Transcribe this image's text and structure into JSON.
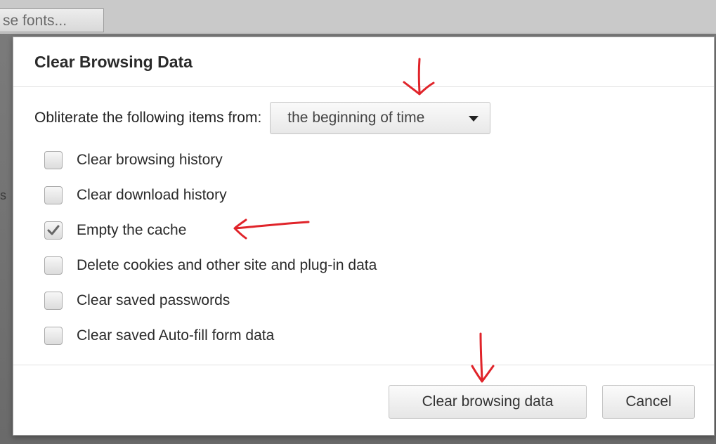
{
  "background": {
    "fonts_button_text": "se fonts..."
  },
  "dialog": {
    "title": "Clear Browsing Data",
    "time_range": {
      "label": "Obliterate the following items from:",
      "selected": "the beginning of time"
    },
    "options": [
      {
        "label": "Clear browsing history",
        "checked": false
      },
      {
        "label": "Clear download history",
        "checked": false
      },
      {
        "label": "Empty the cache",
        "checked": true
      },
      {
        "label": "Delete cookies and other site and plug-in data",
        "checked": false
      },
      {
        "label": "Clear saved passwords",
        "checked": false
      },
      {
        "label": "Clear saved Auto-fill form data",
        "checked": false
      }
    ],
    "buttons": {
      "clear": "Clear browsing data",
      "cancel": "Cancel"
    }
  },
  "colors": {
    "annotation": "#e0242a",
    "checkmark": "#666666"
  },
  "icons": {
    "dropdown": "caret-down-icon",
    "check": "checkmark-icon",
    "annotation_arrow": "hand-drawn-arrow-icon"
  }
}
